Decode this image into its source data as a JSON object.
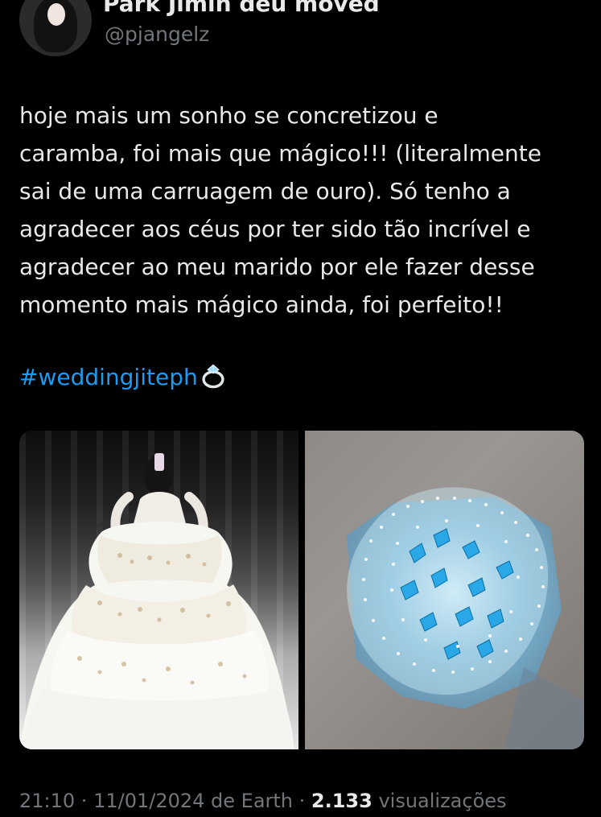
{
  "tweet": {
    "display_name": "Park Jimin deu moved",
    "handle": "@pjangelz",
    "text": "hoje mais um sonho se concretizou e\ncaramba, foi mais que mágico!!! (literalmente\nsai de uma carruagem de ouro). Só tenho a\nagradecer aos céus por ter sido tão incrível e\nagradecer ao meu marido por ele fazer desse\nmomento mais mágico ainda, foi perfeito!!",
    "hashtag": "#weddingjiteph",
    "meta": {
      "time": "21:10",
      "separator1": " · ",
      "date": "11/01/2024",
      "location_prefix": " de ",
      "location": "Earth",
      "separator2": " · ",
      "views": "2.133",
      "views_label": " visualizações"
    }
  },
  "colors": {
    "background": "#000000",
    "text": "#e7e9ea",
    "secondary_text": "#71767b",
    "link": "#1d9bf0",
    "butterfly_blue": "#2aa7e6"
  },
  "icons": {
    "hashtag_emoji": "ring-icon"
  }
}
